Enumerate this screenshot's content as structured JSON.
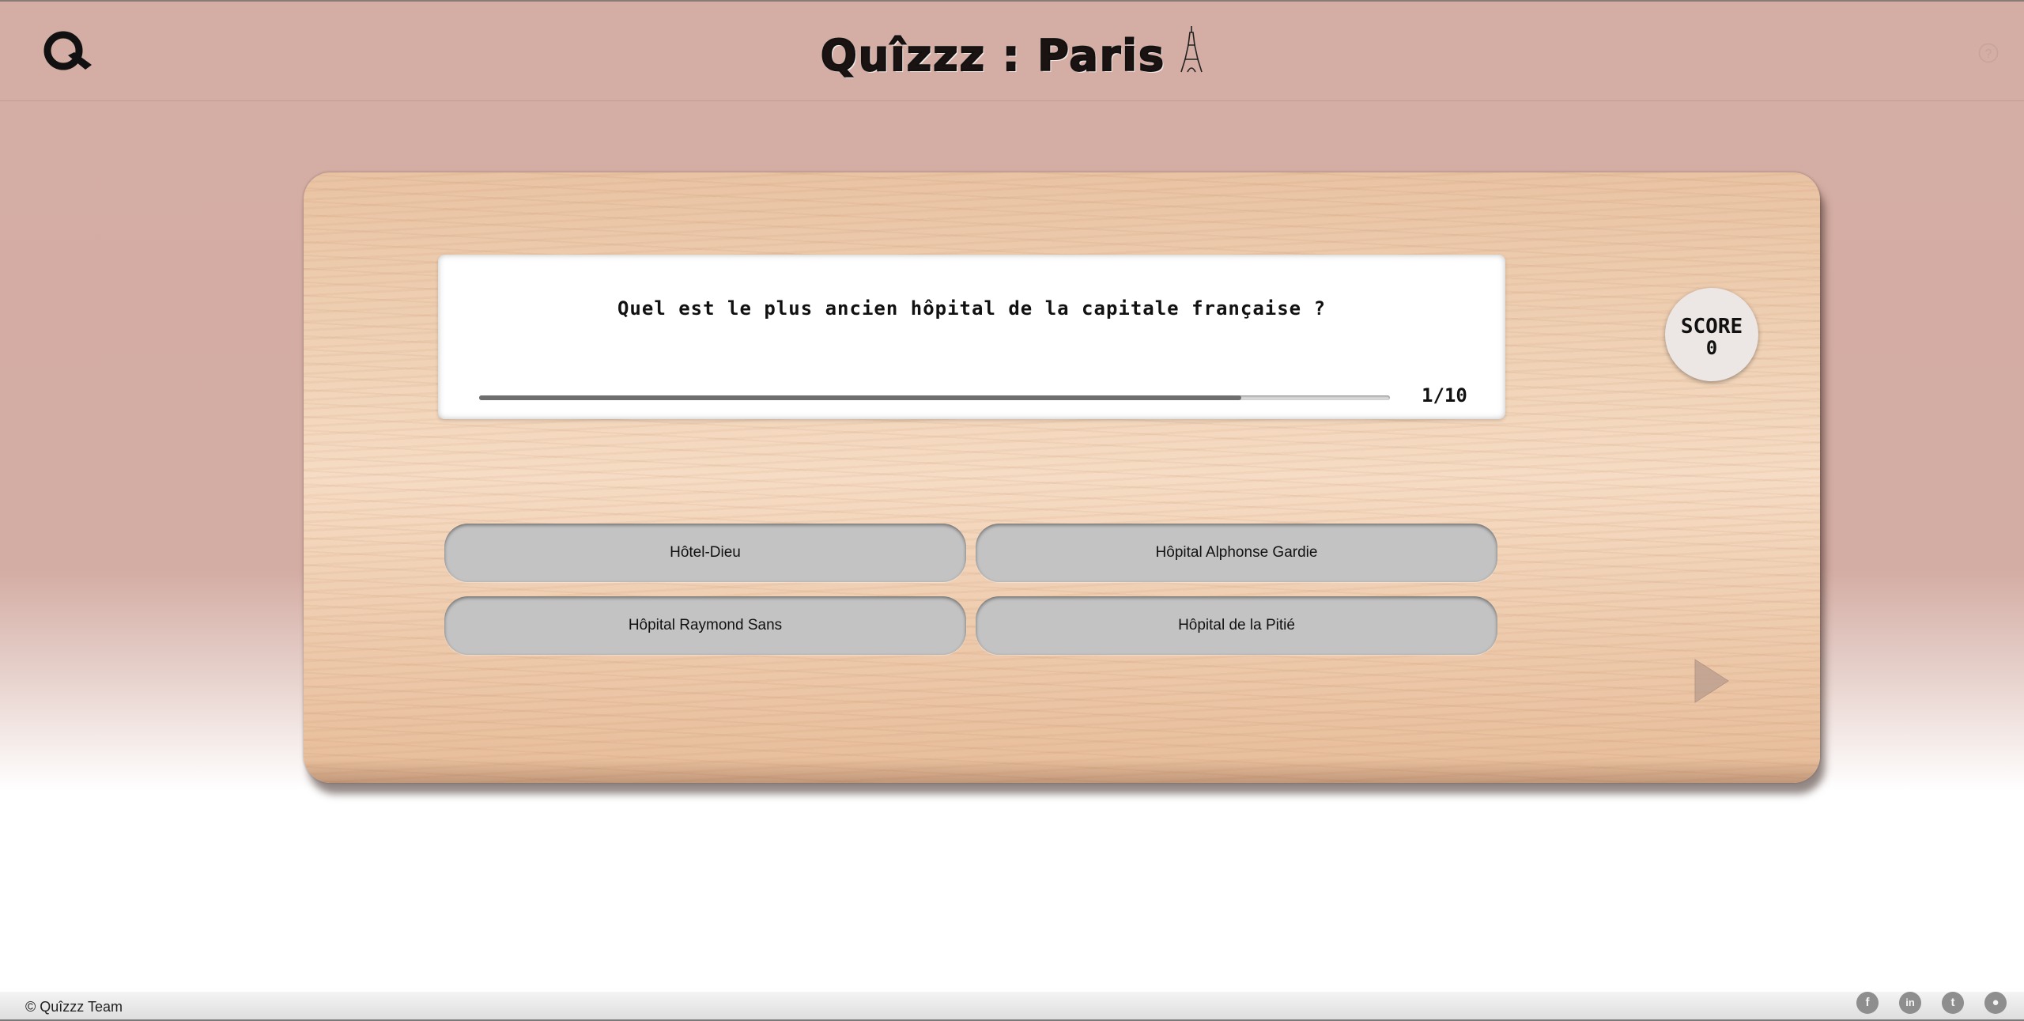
{
  "header": {
    "logo_icon": "quizzz-logo-icon",
    "title": "Quîzzz : Paris",
    "title_icon": "eiffel-tower-icon",
    "help_icon": "question-mark-icon"
  },
  "quiz": {
    "question": "Quel est le plus ancien hôpital de la capitale française ?",
    "progress_fraction": 0.837,
    "counter": "1/10",
    "score_label": "SCORE",
    "score_value": "0",
    "answers": [
      {
        "label": "Hôtel-Dieu"
      },
      {
        "label": "Hôpital Alphonse Gardie"
      },
      {
        "label": "Hôpital Raymond Sans"
      },
      {
        "label": "Hôpital de la Pitié"
      }
    ],
    "next_icon": "play-triangle-icon"
  },
  "footer": {
    "copyright": "© Quîzzz Team",
    "social": [
      {
        "icon": "facebook-icon",
        "glyph": "f"
      },
      {
        "icon": "linkedin-icon",
        "glyph": "in"
      },
      {
        "icon": "twitter-icon",
        "glyph": "t"
      },
      {
        "icon": "github-icon",
        "glyph": "●"
      }
    ]
  },
  "colors": {
    "background_top": "#d4ada4",
    "answer_button": "#c3c3c3",
    "progress_fill": "#6e6e6e",
    "score_circle": "#ece6e4",
    "social_icon": "#8e8e8e"
  }
}
